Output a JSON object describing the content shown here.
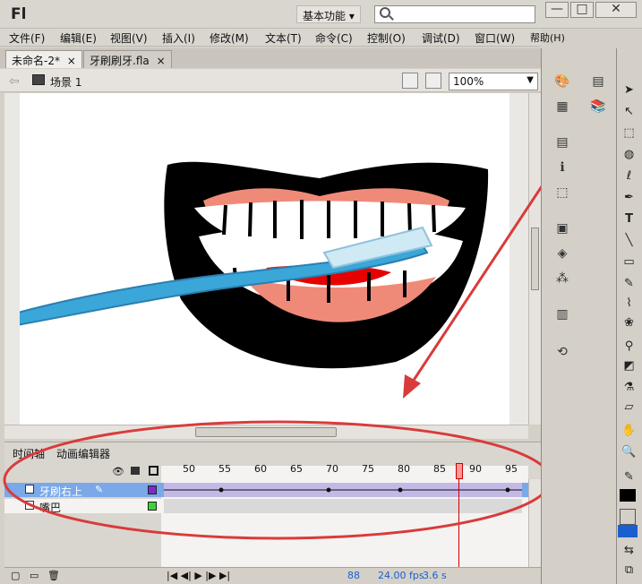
{
  "app": {
    "logo": "Fl",
    "workspace": "基本功能 ▾"
  },
  "window_buttons": [
    "—",
    "□",
    "✕"
  ],
  "menu": [
    "文件(F)",
    "编辑(E)",
    "视图(V)",
    "插入(I)",
    "修改(M)",
    "文本(T)",
    "命令(C)",
    "控制(O)",
    "调试(D)",
    "窗口(W)",
    "帮助(H)"
  ],
  "doc_tabs": [
    {
      "label": "未命名-2*",
      "close": "×"
    },
    {
      "label": "牙刷刷牙.fla",
      "close": "×"
    }
  ],
  "scene": {
    "label": "场景 1",
    "zoom": "100%"
  },
  "timeline": {
    "tabs": [
      "时间轴",
      "动画编辑器"
    ],
    "frame_numbers": [
      "50",
      "55",
      "60",
      "65",
      "70",
      "75",
      "80",
      "85",
      "90",
      "95"
    ],
    "current_frame": 88,
    "layers": [
      {
        "name": "牙刷右上",
        "color": "#7b2cc9",
        "selected": true
      },
      {
        "name": "嘴巴",
        "color": "#38d438",
        "selected": false
      }
    ],
    "status": {
      "frame": "88",
      "fps": "24.00 fps",
      "time": "3.6 s"
    }
  },
  "colors": {
    "accent": "#d93b3b",
    "stroke_swatch": "#000000",
    "fill_swatch": "#1a5fcf",
    "playhead": "#ff9a9a"
  },
  "tools": [
    "selection-tool",
    "subselection-tool",
    "free-transform-tool",
    "3d-rotation-tool",
    "lasso-tool",
    "pen-tool",
    "text-tool",
    "line-tool",
    "rectangle-tool",
    "pencil-tool",
    "brush-tool",
    "deco-tool",
    "bone-tool",
    "paint-bucket-tool",
    "eyedropper-tool",
    "eraser-tool",
    "hand-tool",
    "zoom-tool"
  ]
}
